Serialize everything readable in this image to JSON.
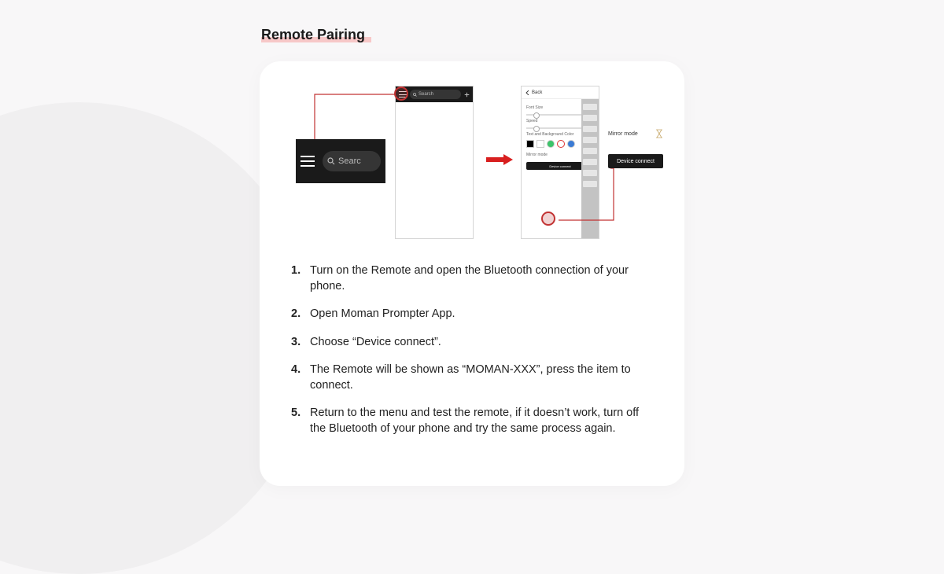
{
  "title": "Remote Pairing",
  "zoom": {
    "search_label": "Searc"
  },
  "phone1": {
    "search_label": "Search"
  },
  "phone2": {
    "back": "Back",
    "font_size_label": "Font Size",
    "speed_label": "Speed",
    "text_bg_label": "Text and Background Color",
    "mirror_label": "Mirror mode",
    "device_connect": "Device connect"
  },
  "callout_right": {
    "mirror": "Mirror mode",
    "device_connect": "Device connect"
  },
  "steps": [
    "Turn on the Remote and open the Bluetooth connection of your phone.",
    "Open Moman Prompter App.",
    "Choose “Device connect”.",
    "The Remote will be shown as “MOMAN-XXX”, press the item to connect.",
    "Return to the menu and test the remote, if it doesn’t work, turn off the Bluetooth of your phone and try the same process again."
  ]
}
